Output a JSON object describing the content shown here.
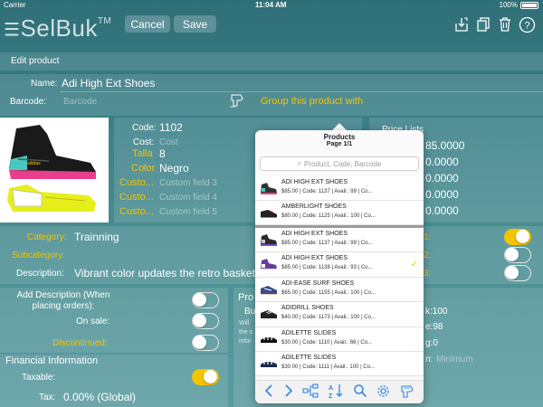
{
  "status": {
    "carrier": "Carrier",
    "time": "11:04 AM",
    "battery": "100%"
  },
  "header": {
    "logo": "SelBuk",
    "logo_mark": "TM",
    "cancel_label": "Cancel",
    "save_label": "Save"
  },
  "title_bar": {
    "title": "Edit product"
  },
  "form": {
    "name_label": "Name:",
    "name_value": "Adi High Ext Shoes",
    "barcode_label": "Barcode:",
    "barcode_placeholder": "Barcode",
    "group_link": "Group this product with"
  },
  "details": {
    "code_label": "Code:",
    "code_value": "1102",
    "cost_label": "Cost:",
    "cost_placeholder": "Cost",
    "talla_label": "Talla",
    "talla_value": "8",
    "color_label": "Color",
    "color_value": "Negro",
    "custom1_label": "Custo...",
    "custom1_placeholder": "Custom field 3",
    "custom2_label": "Custo...",
    "custom2_placeholder": "Custom field 4",
    "custom3_label": "Custo...",
    "custom3_placeholder": "Custom field 5"
  },
  "price_lists": {
    "title": "Price Lists",
    "values": [
      "85.0000",
      "0.0000",
      "0.0000",
      "0.0000",
      "0.0000"
    ]
  },
  "category": {
    "category_label": "Category:",
    "category_value": "Trainning",
    "subcategory_label": "Subcategory:",
    "description_label": "Description:",
    "description_value": "Vibrant color updates the retro basket",
    "right_labels": [
      "1:",
      "2:",
      "3:"
    ]
  },
  "options": {
    "add_desc_label": "Add Description (When placing orders):",
    "on_sale_label": "On sale:",
    "discontinued_label": "Discontinued:"
  },
  "financial": {
    "title": "Financial Information",
    "taxable_label": "Taxable:",
    "tax_label": "Tax:",
    "tax_value": "0.00% (Global)"
  },
  "pro_panel": {
    "title": "Pro",
    "line1": "Bu",
    "line2": "Will",
    "line3": "the s",
    "line4": "infor"
  },
  "right_stats": {
    "stat1": "k:100",
    "stat2": "e:98",
    "stat3": "g:0",
    "stat4": "n:",
    "stat4_placeholder": "Minimum"
  },
  "popup": {
    "title": "Products",
    "subtitle": "Page 1/1",
    "search_placeholder": "Product, Code, Barcode",
    "pinned": [
      {
        "name": "ADI HIGH EXT SHOES",
        "details": "$85.00 | Code: 1137 | Avail.: 99 | Co..."
      },
      {
        "name": "AMBERLIGHT SHOES",
        "details": "$80.00 | Code: 1125 | Avail.: 100 | Co..."
      }
    ],
    "items": [
      {
        "name": "ADI HIGH EXT SHOES",
        "details": "$85.00 | Code: 1137 | Avail.: 99 | Co...",
        "checked": false
      },
      {
        "name": "ADI HIGH EXT SHOES",
        "details": "$85.00 | Code: 1138 | Avail.: 93 | Co...",
        "checked": true
      },
      {
        "name": "ADI-EASE SURF SHOES",
        "details": "$65.00 | Code: 1155 | Avail.: 100 | Co...",
        "checked": false
      },
      {
        "name": "ADIDRILL SHOES",
        "details": "$40.00 | Code: 1173 | Avail.: 100 | Co...",
        "checked": false
      },
      {
        "name": "ADILETTE SLIDES",
        "details": "$30.00 | Code: 1110 | Avail.: 66 | Co...",
        "checked": false
      },
      {
        "name": "ADILETTE SLIDES",
        "details": "$30.00 | Code: 1111 | Avail.: 100 | Co...",
        "checked": false
      }
    ],
    "toolbar_icons": [
      "chevron-left-icon",
      "chevron-right-icon",
      "hierarchy-icon",
      "sort-az-icon",
      "search-icon",
      "gear-icon",
      "barcode-scanner-icon"
    ]
  },
  "colors": {
    "accent": "#f4c400",
    "link_blue": "#2e86de",
    "background": "#3b8088"
  }
}
